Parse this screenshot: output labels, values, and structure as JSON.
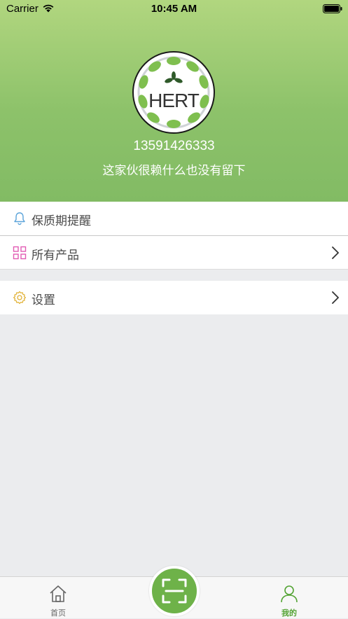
{
  "status_bar": {
    "carrier": "Carrier",
    "time": "10:45 AM",
    "wifi_icon": "wifi-icon",
    "battery_icon": "battery-icon"
  },
  "profile": {
    "avatar_text": "HERT",
    "phone": "13591426333",
    "bio": "这家伙很赖什么也没有留下"
  },
  "menu": {
    "items": [
      {
        "label": "保质期提醒",
        "icon": "bell-icon",
        "color": "#5aa3d9",
        "has_chevron": false
      },
      {
        "label": "所有产品",
        "icon": "grid-icon",
        "color": "#e25bb3",
        "has_chevron": true
      },
      {
        "label": "设置",
        "icon": "gear-icon",
        "color": "#e2b43c",
        "has_chevron": true
      }
    ]
  },
  "tabbar": {
    "home_label": "首页",
    "mine_label": "我的",
    "scan_icon": "scan-icon",
    "active_color": "#53a333"
  },
  "colors": {
    "header_top": "#b1d67f",
    "header_bottom": "#82bb64",
    "background": "#ebecee"
  }
}
